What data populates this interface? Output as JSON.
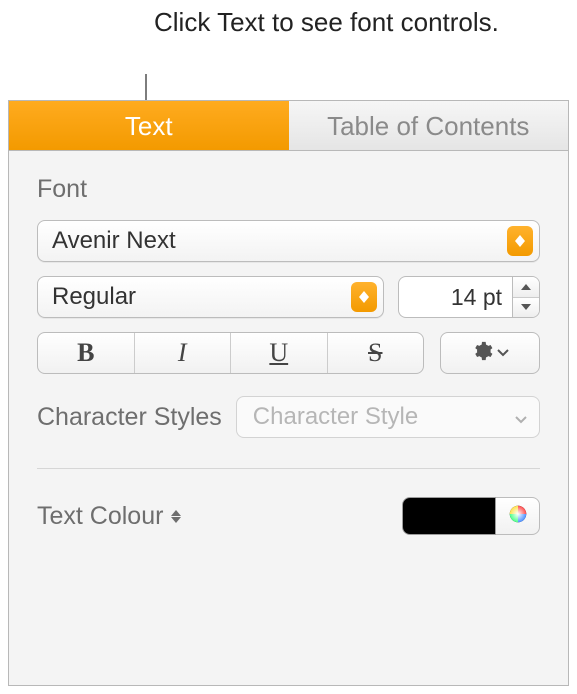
{
  "callout": "Click Text to see font controls.",
  "tabs": {
    "text": "Text",
    "toc": "Table of Contents"
  },
  "font": {
    "section_label": "Font",
    "family": "Avenir Next",
    "weight": "Regular",
    "size": "14 pt"
  },
  "styles": {
    "bold": "B",
    "italic": "I",
    "underline": "U",
    "strike": "S"
  },
  "char_styles": {
    "label": "Character Styles",
    "placeholder": "Character Style"
  },
  "text_colour": {
    "label": "Text Colour",
    "value": "#000000"
  }
}
